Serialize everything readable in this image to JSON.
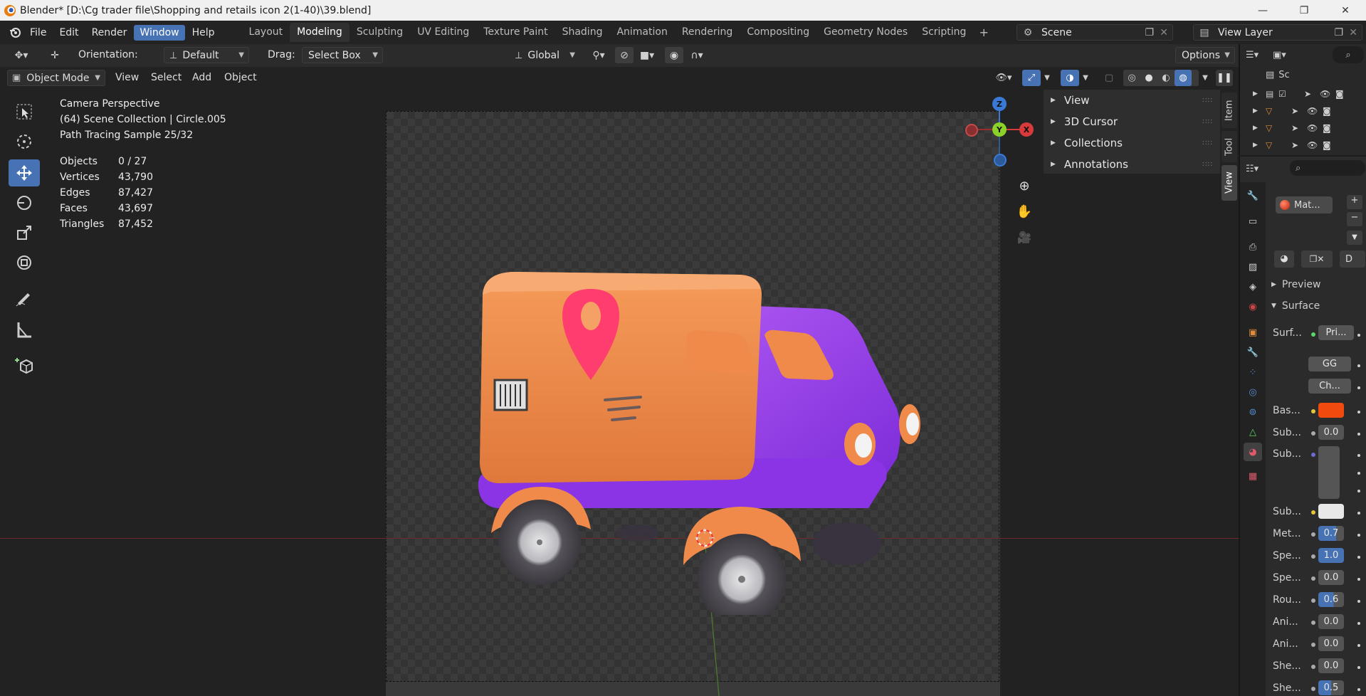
{
  "window": {
    "title": "Blender* [D:\\Cg trader file\\Shopping and retails icon 2(1-40)\\39.blend]",
    "minimize": "—",
    "maximize": "❐",
    "close": "✕"
  },
  "menubar": {
    "items": [
      "File",
      "Edit",
      "Render",
      "Window",
      "Help"
    ],
    "active": "Window",
    "workspaces": [
      "Layout",
      "Modeling",
      "Sculpting",
      "UV Editing",
      "Texture Paint",
      "Shading",
      "Animation",
      "Rendering",
      "Compositing",
      "Geometry Nodes",
      "Scripting"
    ],
    "active_workspace": "Modeling",
    "add_workspace": "+",
    "scene": "Scene",
    "view_layer": "View Layer"
  },
  "toolbar": {
    "orientation_label": "Orientation:",
    "orientation_value": "Default",
    "drag_label": "Drag:",
    "drag_value": "Select Box",
    "transform_space": "Global",
    "options": "Options"
  },
  "viewport_header": {
    "mode": "Object Mode",
    "menus": [
      "View",
      "Select",
      "Add",
      "Object"
    ]
  },
  "overlay_info": {
    "line1": "Camera Perspective",
    "line2": "(64) Scene Collection | Circle.005",
    "line3": "Path Tracing Sample 25/32",
    "stats": [
      {
        "label": "Objects",
        "value": "0 / 27"
      },
      {
        "label": "Vertices",
        "value": "43,790"
      },
      {
        "label": "Edges",
        "value": "87,427"
      },
      {
        "label": "Faces",
        "value": "43,697"
      },
      {
        "label": "Triangles",
        "value": "87,452"
      }
    ]
  },
  "gizmo": {
    "z": "Z",
    "y": "Y",
    "x": "X"
  },
  "npanel": {
    "sections": [
      "View",
      "3D Cursor",
      "Collections",
      "Annotations"
    ],
    "tabs": [
      "Item",
      "Tool",
      "View"
    ],
    "active_tab": "View"
  },
  "outliner": {
    "first_row": "Sc"
  },
  "properties": {
    "material_slot": "Mat...",
    "data_dropdown": "D",
    "sections": {
      "preview": "Preview",
      "surface": "Surface"
    },
    "rows": [
      {
        "label": "Surf...",
        "value": "Pri...",
        "kind": "node"
      },
      {
        "label": "",
        "value": "GG",
        "kind": "dropdown"
      },
      {
        "label": "",
        "value": "Ch...",
        "kind": "dropdown"
      },
      {
        "label": "Bas...",
        "value": "",
        "kind": "color",
        "color": "#f04a0e"
      },
      {
        "label": "Sub...",
        "value": "0.0",
        "kind": "number"
      },
      {
        "label": "Sub...",
        "value": "",
        "kind": "vector"
      },
      {
        "label": "Sub...",
        "value": "",
        "kind": "color",
        "color": "#e8e8e8"
      },
      {
        "label": "Met...",
        "value": "0.7",
        "kind": "slider",
        "fill": 0.7
      },
      {
        "label": "Spe...",
        "value": "1.0",
        "kind": "slider",
        "fill": 1.0
      },
      {
        "label": "Spe...",
        "value": "0.0",
        "kind": "number"
      },
      {
        "label": "Rou...",
        "value": "0.6",
        "kind": "slider",
        "fill": 0.6
      },
      {
        "label": "Ani...",
        "value": "0.0",
        "kind": "number"
      },
      {
        "label": "Ani...",
        "value": "0.0",
        "kind": "number"
      },
      {
        "label": "She...",
        "value": "0.0",
        "kind": "number"
      },
      {
        "label": "She...",
        "value": "0.5",
        "kind": "slider",
        "fill": 0.5
      }
    ]
  },
  "colors": {
    "accent": "#4772b3",
    "truck_cargo": "#f08a4b",
    "truck_cab": "#9a3ef0",
    "pin": "#ff3d6e"
  }
}
